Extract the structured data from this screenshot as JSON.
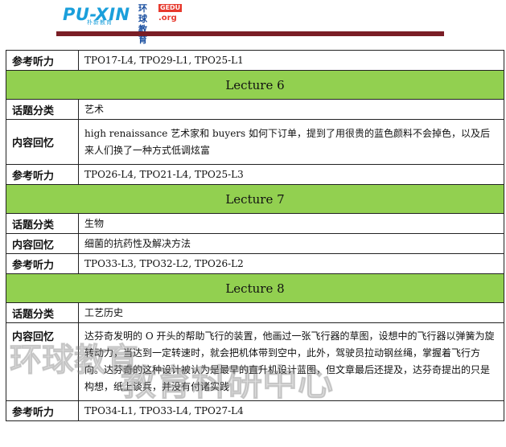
{
  "header": {
    "logo_brand": "PU-XIN",
    "logo_brand_sub": "朴新教育",
    "logo_hq_line1": "环球",
    "logo_hq_line2": "教育",
    "logo_gedu": "GEDU",
    "logo_org": ".org"
  },
  "rows": {
    "r0_label": "参考听力",
    "r0_value": "TPO17-L4, TPO29-L1, TPO25-L1",
    "lec6_title": "Lecture 6",
    "r1_label": "话题分类",
    "r1_value": "艺术",
    "r2_label": "内容回忆",
    "r2_value": "high renaissance 艺术家和 buyers 如何下订单，提到了用很贵的蓝色颜料不会掉色，以及后来人们换了一种方式低调炫富",
    "r3_label": "参考听力",
    "r3_value": "TPO26-L4, TPO21-L4, TPO25-L3",
    "lec7_title": "Lecture 7",
    "r4_label": "话题分类",
    "r4_value": "生物",
    "r5_label": "内容回忆",
    "r5_value": "细菌的抗药性及解决方法",
    "r6_label": "参考听力",
    "r6_value": "TPO33-L3, TPO32-L2, TPO26-L2",
    "lec8_title": "Lecture 8",
    "r7_label": "话题分类",
    "r7_value": "工艺历史",
    "r8_label": "内容回忆",
    "r8_value": "达芬奇发明的 O 开头的帮助飞行的装置，他画过一张飞行器的草图，设想中的飞行器以弹簧为旋转动力，当达到一定转速时，就会把机体带到空中，此外，驾驶员拉动钢丝绳，掌握着飞行方向。达芬奇的这种设计被认为是最早的直升机设计蓝图，但文章最后还提及，达芬奇提出的只是构想，纸上谈兵，并没有付诸实践",
    "r9_label": "参考听力",
    "r9_value": "TPO34-L1, TPO33-L4, TPO27-L4"
  },
  "watermark": {
    "line1": "环球教育",
    "line2": "教育科研中心"
  },
  "colors": {
    "section_green": "#92d050",
    "rule_maroon": "#7a1e26",
    "logo_blue": "#1a9fdb",
    "logo_red": "#e73a2e"
  }
}
